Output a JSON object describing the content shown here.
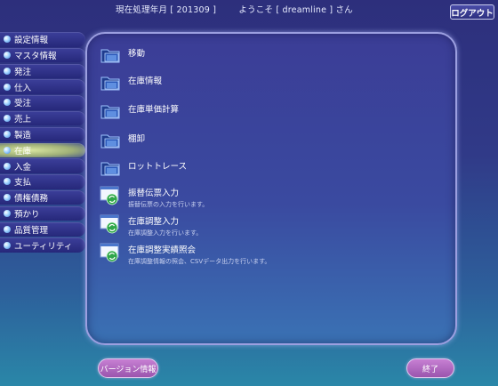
{
  "header": {
    "period_label": "現在処理年月 [ 201309 ]",
    "welcome": "ようこそ [ dreamline ] さん",
    "logout_label": "ログアウト"
  },
  "sidebar": {
    "items": [
      {
        "label": "設定情報"
      },
      {
        "label": "マスタ情報"
      },
      {
        "label": "発注"
      },
      {
        "label": "仕入"
      },
      {
        "label": "受注"
      },
      {
        "label": "売上"
      },
      {
        "label": "製造"
      },
      {
        "label": "在庫",
        "active": true
      },
      {
        "label": "入金"
      },
      {
        "label": "支払"
      },
      {
        "label": "債権債務"
      },
      {
        "label": "預かり"
      },
      {
        "label": "品質管理"
      },
      {
        "label": "ユーティリティ"
      }
    ]
  },
  "menu": {
    "items": [
      {
        "label": "移動",
        "desc": "",
        "icon": "folder-icon"
      },
      {
        "label": "在庫情報",
        "desc": "",
        "icon": "folder-icon"
      },
      {
        "label": "在庫単価計算",
        "desc": "",
        "icon": "folder-icon"
      },
      {
        "label": "棚卸",
        "desc": "",
        "icon": "folder-icon"
      },
      {
        "label": "ロットトレース",
        "desc": "",
        "icon": "folder-icon"
      },
      {
        "label": "振替伝票入力",
        "desc": "振替伝票の入力を行います。",
        "icon": "document-refresh-icon"
      },
      {
        "label": "在庫調整入力",
        "desc": "在庫調整入力を行います。",
        "icon": "document-refresh-icon"
      },
      {
        "label": "在庫調整実績照会",
        "desc": "在庫調整情報の照会、CSVデータ出力を行います。",
        "icon": "document-refresh-icon"
      }
    ]
  },
  "footer": {
    "version_label": "バージョン情報",
    "end_label": "終了"
  },
  "colors": {
    "background_top": "#2d2f7c",
    "background_bottom": "#2a87a8",
    "sidebar_item": "#2e3082",
    "sidebar_active": "#c8d89a",
    "button_purple": "#b06cc2"
  }
}
